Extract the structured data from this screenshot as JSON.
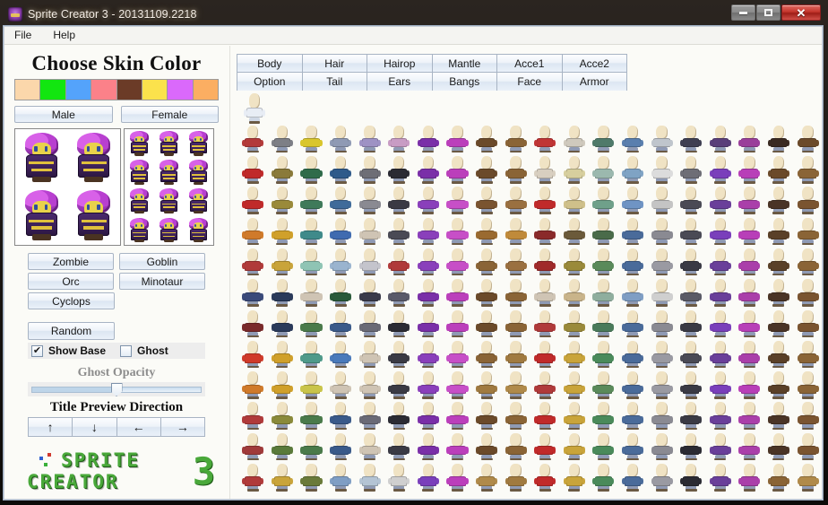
{
  "window": {
    "title": "Sprite Creator 3 - 20131109.2218",
    "icon": "app-sprite-icon",
    "buttons": {
      "minimize": "–",
      "maximize": "□",
      "close": "✕"
    }
  },
  "menubar": {
    "items": [
      {
        "label": "File"
      },
      {
        "label": "Help"
      }
    ]
  },
  "left_panel": {
    "skin_title": "Choose Skin Color",
    "swatches": [
      {
        "name": "skin-pale",
        "color": "#fbd7ab"
      },
      {
        "name": "skin-green",
        "color": "#12e610"
      },
      {
        "name": "skin-blue",
        "color": "#54a3fb"
      },
      {
        "name": "skin-pink",
        "color": "#fb8189"
      },
      {
        "name": "skin-brown",
        "color": "#6b3b27"
      },
      {
        "name": "skin-yellow",
        "color": "#fbe24c"
      },
      {
        "name": "skin-purple",
        "color": "#da69fb"
      },
      {
        "name": "skin-orange",
        "color": "#fbae62"
      }
    ],
    "gender": {
      "male": "Male",
      "female": "Female"
    },
    "monsters": [
      "Zombie",
      "Goblin",
      "Orc",
      "Minotaur",
      "Cyclops"
    ],
    "random_label": "Random",
    "checkboxes": [
      {
        "label": "Show Base",
        "checked": true,
        "mark": "✔"
      },
      {
        "label": "Ghost",
        "checked": false,
        "mark": ""
      }
    ],
    "ghost_opacity": {
      "label": "Ghost Opacity",
      "value_percent": 50
    },
    "title_preview_direction": {
      "label": "Title Preview Direction",
      "buttons": [
        {
          "name": "direction-up",
          "glyph": "↑"
        },
        {
          "name": "direction-down",
          "glyph": "↓"
        },
        {
          "name": "direction-left",
          "glyph": "←"
        },
        {
          "name": "direction-right",
          "glyph": "→"
        }
      ]
    },
    "logo": {
      "line1": "SPRITE",
      "line2": "CREATOR",
      "version": "3",
      "color": "#49a83a"
    },
    "preview_hero": {
      "hair_color": "#c44fdd",
      "face_color": "#e8d24b",
      "body_color": "#3b2057",
      "trim_color": "#e0c03c"
    }
  },
  "right_panel": {
    "tabs": [
      {
        "label": "Body",
        "selected": true
      },
      {
        "label": "Hair",
        "selected": false
      },
      {
        "label": "Hairop",
        "selected": false
      },
      {
        "label": "Mantle",
        "selected": false
      },
      {
        "label": "Acce1",
        "selected": false
      },
      {
        "label": "Acce2",
        "selected": false
      },
      {
        "label": "Option",
        "selected": false
      },
      {
        "label": "Tail",
        "selected": false
      },
      {
        "label": "Ears",
        "selected": false
      },
      {
        "label": "Bangs",
        "selected": false
      },
      {
        "label": "Face",
        "selected": false
      },
      {
        "label": "Armor",
        "selected": false
      }
    ],
    "grid": {
      "columns": 20,
      "rows": 12,
      "skin_color": "#f0e3c4",
      "legs_color": "#8f9ab4",
      "preview_cell_name": "sprite-preview-base",
      "row_palettes": [
        [
          "#b33a3a",
          "#7d7f86",
          "#d9c62d",
          "#8f9ab4",
          "#9e92c4",
          "#c89cc4",
          "#7a2fa8",
          "#bb3fbb",
          "#6b4a2a",
          "#8a6436",
          "#c03535",
          "#cfc9bd",
          "#4f7a6a",
          "#5a7fae",
          "#bfc5cc",
          "#3f3f52",
          "#5a3f7a",
          "#9a3f9a",
          "#3a2a22",
          "#6b4a2a"
        ],
        [
          "#c02a2a",
          "#8a7a3a",
          "#2f6b4a",
          "#2f5a8a",
          "#6e6e76",
          "#2b2b33",
          "#7a2fa8",
          "#bb3fbb",
          "#6b4a2a",
          "#8a6436",
          "#d8cfc0",
          "#d7cf9e",
          "#9bb8ae",
          "#7fa3c4",
          "#dcdcdc",
          "#6e6e76",
          "#7a3fbb",
          "#b83fb8",
          "#6b4a2a",
          "#8a6436"
        ],
        [
          "#c02a2a",
          "#9a8a3a",
          "#3f7a5a",
          "#3f6b9a",
          "#8a8a92",
          "#3a3a44",
          "#8a3fbb",
          "#c74fc7",
          "#7a5430",
          "#9a7040",
          "#c02a2a",
          "#cfc08a",
          "#6fa08a",
          "#6f94c4",
          "#c4c4c4",
          "#4a4a55",
          "#6a3f9a",
          "#aa3faa",
          "#4a3426",
          "#7a5430"
        ],
        [
          "#d07a2a",
          "#d0a02a",
          "#3f8a8a",
          "#3f6bb0",
          "#cfc4b4",
          "#4a4a55",
          "#8a3fbb",
          "#c74fc7",
          "#9a6a30",
          "#c08a3a",
          "#8a2a2a",
          "#6b5a3a",
          "#4a6b4a",
          "#4a6b9a",
          "#8a8a92",
          "#4a4a55",
          "#7a3fbb",
          "#b83fb8",
          "#5a4028",
          "#8a6436"
        ],
        [
          "#b03a3a",
          "#c9a43a",
          "#8fc4b4",
          "#9ab4cf",
          "#c4c4cc",
          "#b03a3a",
          "#8a3fbb",
          "#c74fc7",
          "#8a6436",
          "#9a7040",
          "#a02a2a",
          "#9a8a3a",
          "#5a8a5a",
          "#4a6b9a",
          "#9a9aa2",
          "#3a3a44",
          "#6a3f9a",
          "#aa3faa",
          "#5a4028",
          "#8a6436"
        ],
        [
          "#3a4a7a",
          "#2a3a5a",
          "#cfc4b4",
          "#2a5a3a",
          "#3a3a4a",
          "#5a5a6a",
          "#7a2fa8",
          "#bb3fbb",
          "#6b4a2a",
          "#8a6436",
          "#cfc4b4",
          "#c9b48a",
          "#8fae9e",
          "#7f9ec4",
          "#cfcfcf",
          "#5a5a66",
          "#6a3f9a",
          "#aa3faa",
          "#4a3426",
          "#7a5430"
        ],
        [
          "#7a2a2a",
          "#2a3a5a",
          "#4a7a4a",
          "#3a5a8a",
          "#6a6a76",
          "#2b2b33",
          "#7a2fa8",
          "#bb3fbb",
          "#6b4a2a",
          "#8a6436",
          "#b03a3a",
          "#9a8a3a",
          "#4a7a5a",
          "#4a6b9a",
          "#8a8a92",
          "#3a3a44",
          "#7a3fbb",
          "#b83fb8",
          "#4a3426",
          "#7a5430"
        ],
        [
          "#d03a2a",
          "#d0a02a",
          "#4f9a8a",
          "#4a7abb",
          "#cfc4b4",
          "#3a3a44",
          "#8a3fbb",
          "#c74fc7",
          "#8a6436",
          "#a07a40",
          "#c02a2a",
          "#c9a43a",
          "#4a8a5a",
          "#4a6b9a",
          "#9a9aa2",
          "#4a4a55",
          "#6a3f9a",
          "#aa3faa",
          "#5a4028",
          "#8a6436"
        ],
        [
          "#d07a2a",
          "#d0a02a",
          "#c9c44a",
          "#cfc4b4",
          "#cfc4b4",
          "#3a3a44",
          "#8a3fbb",
          "#c74fc7",
          "#a07a40",
          "#b08a4a",
          "#b03a3a",
          "#c9a43a",
          "#5a8a5a",
          "#4a6b9a",
          "#9a9aa2",
          "#3a3a44",
          "#7a3fbb",
          "#b83fb8",
          "#5a4028",
          "#8a6436"
        ],
        [
          "#b03a3a",
          "#8a8a3a",
          "#4a7a4a",
          "#3a5a8a",
          "#6a6a76",
          "#2b2b33",
          "#7a2fa8",
          "#bb3fbb",
          "#6b4a2a",
          "#8a6436",
          "#c02a2a",
          "#c9a43a",
          "#4a8a5a",
          "#4a6b9a",
          "#8a8a92",
          "#3a3a44",
          "#6a3f9a",
          "#aa3faa",
          "#4a3426",
          "#7a5430"
        ],
        [
          "#a03a3a",
          "#5a7a3a",
          "#4a7a4a",
          "#3a5a8a",
          "#cfc4b4",
          "#3a3a44",
          "#7a2fa8",
          "#bb3fbb",
          "#6b4a2a",
          "#8a6436",
          "#c02a2a",
          "#c9a43a",
          "#4a8a5a",
          "#4a6b9a",
          "#8a8a92",
          "#2b2b33",
          "#6a3f9a",
          "#aa3faa",
          "#4a3426",
          "#7a5430"
        ],
        [
          "#b03a3a",
          "#c9a43a",
          "#6a7a3a",
          "#7f9ec4",
          "#b4c4d4",
          "#cfcfcf",
          "#7a3fbb",
          "#bb3fbb",
          "#b08a4a",
          "#a07a40",
          "#c02a2a",
          "#c9a43a",
          "#4a8a5a",
          "#4a6b9a",
          "#9a9aa2",
          "#2b2b33",
          "#6a3f9a",
          "#aa3faa",
          "#8a6436",
          "#b08a4a"
        ]
      ]
    }
  }
}
